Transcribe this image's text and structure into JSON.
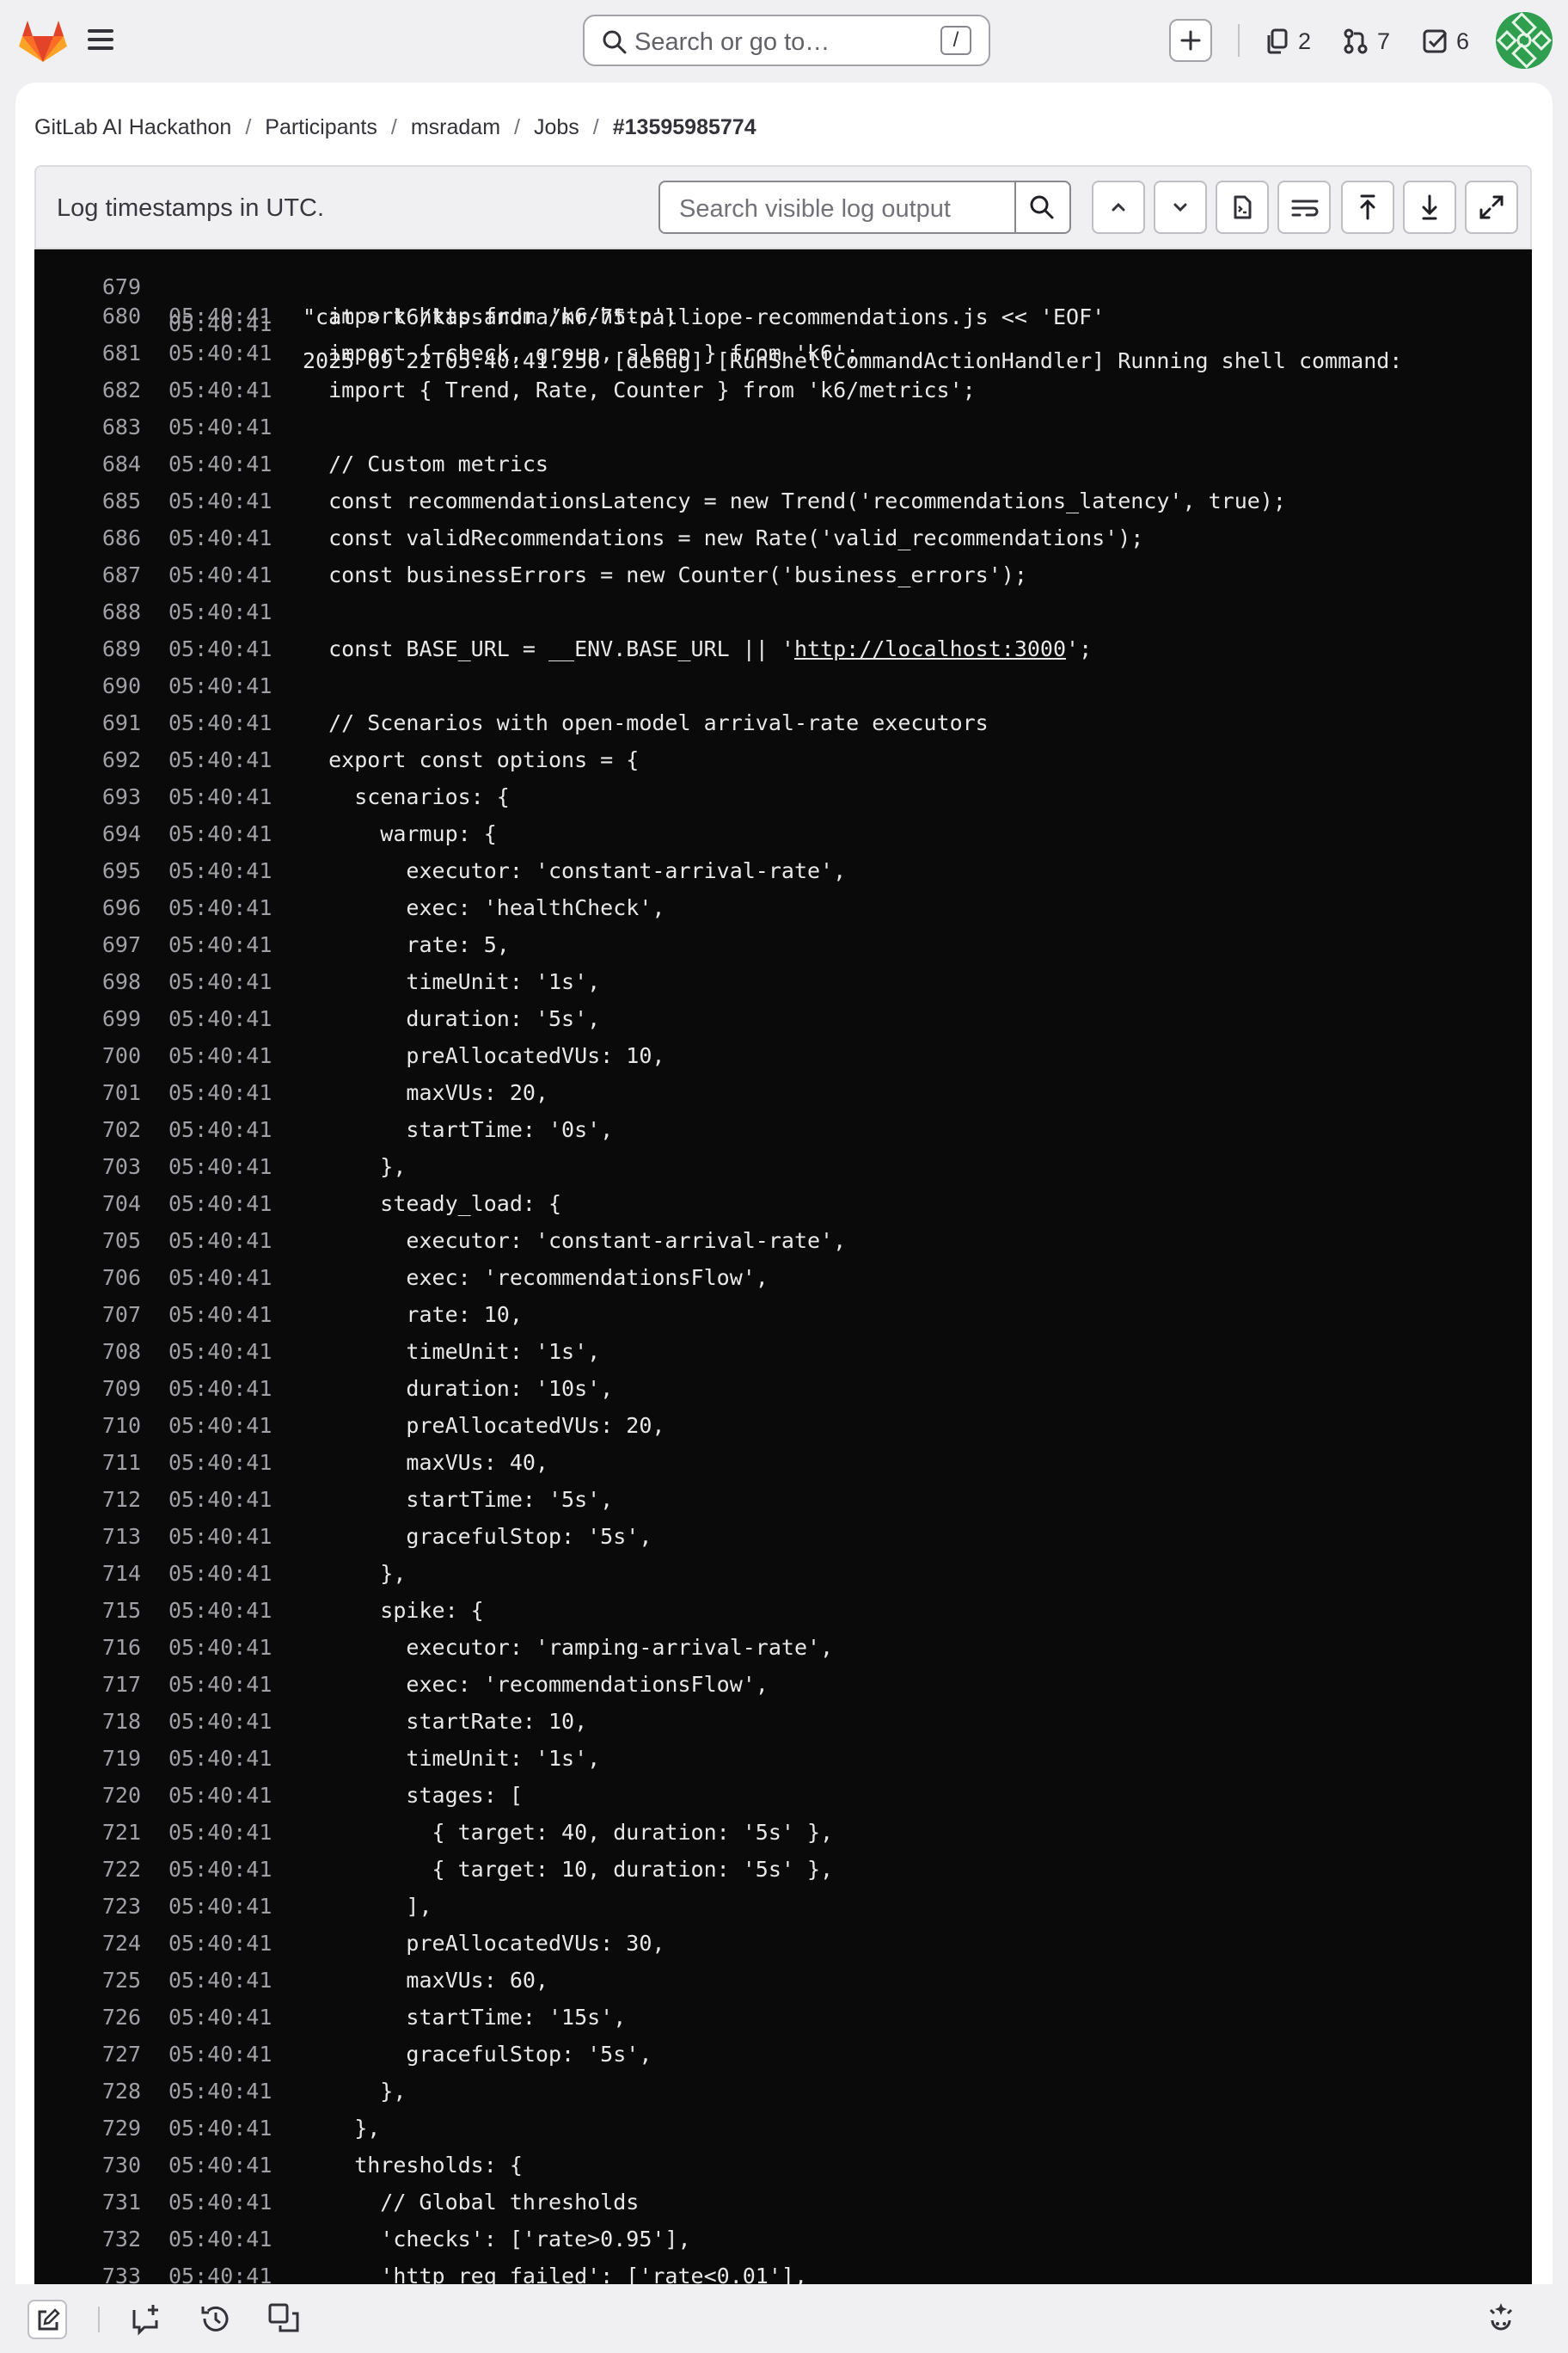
{
  "nav": {
    "search_placeholder": "Search or go to…",
    "search_shortcut": "/",
    "counters": {
      "issues": "2",
      "merge_requests": "7",
      "todos": "6"
    }
  },
  "breadcrumb": [
    "GitLab AI Hackathon",
    "Participants",
    "msradam",
    "Jobs",
    "#13595985774"
  ],
  "log_toolbar": {
    "timestamp_note": "Log timestamps in UTC.",
    "search_placeholder": "Search visible log output"
  },
  "log": {
    "top_fragment_text": "2025 09 22T05:40:41.256 [debug] [RunShellCommandActionHandler] Running shell command:",
    "cmd_line": "\"cat > k6/kassandra/mr-75-calliope-recommendations.js << 'EOF'",
    "lines": [
      {
        "n": "680",
        "t": "05:40:41",
        "c": "  import http from 'k6/http';"
      },
      {
        "n": "681",
        "t": "05:40:41",
        "c": "  import { check, group, sleep } from 'k6';"
      },
      {
        "n": "682",
        "t": "05:40:41",
        "c": "  import { Trend, Rate, Counter } from 'k6/metrics';"
      },
      {
        "n": "683",
        "t": "05:40:41",
        "c": ""
      },
      {
        "n": "684",
        "t": "05:40:41",
        "c": "  // Custom metrics"
      },
      {
        "n": "685",
        "t": "05:40:41",
        "c": "  const recommendationsLatency = new Trend('recommendations_latency', true);"
      },
      {
        "n": "686",
        "t": "05:40:41",
        "c": "  const validRecommendations = new Rate('valid_recommendations');"
      },
      {
        "n": "687",
        "t": "05:40:41",
        "c": "  const businessErrors = new Counter('business_errors');"
      },
      {
        "n": "688",
        "t": "05:40:41",
        "c": ""
      },
      {
        "n": "689",
        "t": "05:40:41",
        "c": "  const BASE_URL = __ENV.BASE_URL || '",
        "link": "http://localhost:3000",
        "after": "';"
      },
      {
        "n": "690",
        "t": "05:40:41",
        "c": ""
      },
      {
        "n": "691",
        "t": "05:40:41",
        "c": "  // Scenarios with open-model arrival-rate executors"
      },
      {
        "n": "692",
        "t": "05:40:41",
        "c": "  export const options = {"
      },
      {
        "n": "693",
        "t": "05:40:41",
        "c": "    scenarios: {"
      },
      {
        "n": "694",
        "t": "05:40:41",
        "c": "      warmup: {"
      },
      {
        "n": "695",
        "t": "05:40:41",
        "c": "        executor: 'constant-arrival-rate',"
      },
      {
        "n": "696",
        "t": "05:40:41",
        "c": "        exec: 'healthCheck',"
      },
      {
        "n": "697",
        "t": "05:40:41",
        "c": "        rate: 5,"
      },
      {
        "n": "698",
        "t": "05:40:41",
        "c": "        timeUnit: '1s',"
      },
      {
        "n": "699",
        "t": "05:40:41",
        "c": "        duration: '5s',"
      },
      {
        "n": "700",
        "t": "05:40:41",
        "c": "        preAllocatedVUs: 10,"
      },
      {
        "n": "701",
        "t": "05:40:41",
        "c": "        maxVUs: 20,"
      },
      {
        "n": "702",
        "t": "05:40:41",
        "c": "        startTime: '0s',"
      },
      {
        "n": "703",
        "t": "05:40:41",
        "c": "      },"
      },
      {
        "n": "704",
        "t": "05:40:41",
        "c": "      steady_load: {"
      },
      {
        "n": "705",
        "t": "05:40:41",
        "c": "        executor: 'constant-arrival-rate',"
      },
      {
        "n": "706",
        "t": "05:40:41",
        "c": "        exec: 'recommendationsFlow',"
      },
      {
        "n": "707",
        "t": "05:40:41",
        "c": "        rate: 10,"
      },
      {
        "n": "708",
        "t": "05:40:41",
        "c": "        timeUnit: '1s',"
      },
      {
        "n": "709",
        "t": "05:40:41",
        "c": "        duration: '10s',"
      },
      {
        "n": "710",
        "t": "05:40:41",
        "c": "        preAllocatedVUs: 20,"
      },
      {
        "n": "711",
        "t": "05:40:41",
        "c": "        maxVUs: 40,"
      },
      {
        "n": "712",
        "t": "05:40:41",
        "c": "        startTime: '5s',"
      },
      {
        "n": "713",
        "t": "05:40:41",
        "c": "        gracefulStop: '5s',"
      },
      {
        "n": "714",
        "t": "05:40:41",
        "c": "      },"
      },
      {
        "n": "715",
        "t": "05:40:41",
        "c": "      spike: {"
      },
      {
        "n": "716",
        "t": "05:40:41",
        "c": "        executor: 'ramping-arrival-rate',"
      },
      {
        "n": "717",
        "t": "05:40:41",
        "c": "        exec: 'recommendationsFlow',"
      },
      {
        "n": "718",
        "t": "05:40:41",
        "c": "        startRate: 10,"
      },
      {
        "n": "719",
        "t": "05:40:41",
        "c": "        timeUnit: '1s',"
      },
      {
        "n": "720",
        "t": "05:40:41",
        "c": "        stages: ["
      },
      {
        "n": "721",
        "t": "05:40:41",
        "c": "          { target: 40, duration: '5s' },"
      },
      {
        "n": "722",
        "t": "05:40:41",
        "c": "          { target: 10, duration: '5s' },"
      },
      {
        "n": "723",
        "t": "05:40:41",
        "c": "        ],"
      },
      {
        "n": "724",
        "t": "05:40:41",
        "c": "        preAllocatedVUs: 30,"
      },
      {
        "n": "725",
        "t": "05:40:41",
        "c": "        maxVUs: 60,"
      },
      {
        "n": "726",
        "t": "05:40:41",
        "c": "        startTime: '15s',"
      },
      {
        "n": "727",
        "t": "05:40:41",
        "c": "        gracefulStop: '5s',"
      },
      {
        "n": "728",
        "t": "05:40:41",
        "c": "      },"
      },
      {
        "n": "729",
        "t": "05:40:41",
        "c": "    },"
      },
      {
        "n": "730",
        "t": "05:40:41",
        "c": "    thresholds: {"
      },
      {
        "n": "731",
        "t": "05:40:41",
        "c": "      // Global thresholds"
      },
      {
        "n": "732",
        "t": "05:40:41",
        "c": "      'checks': ['rate>0.95'],"
      },
      {
        "n": "733",
        "t": "05:40:41",
        "c": "      'http_req_failed': ['rate<0.01'],"
      }
    ]
  },
  "colors": {
    "brand_orange": "#e24329",
    "log_bg": "#0a0a0b",
    "avatar_green": "#3bb45a"
  }
}
